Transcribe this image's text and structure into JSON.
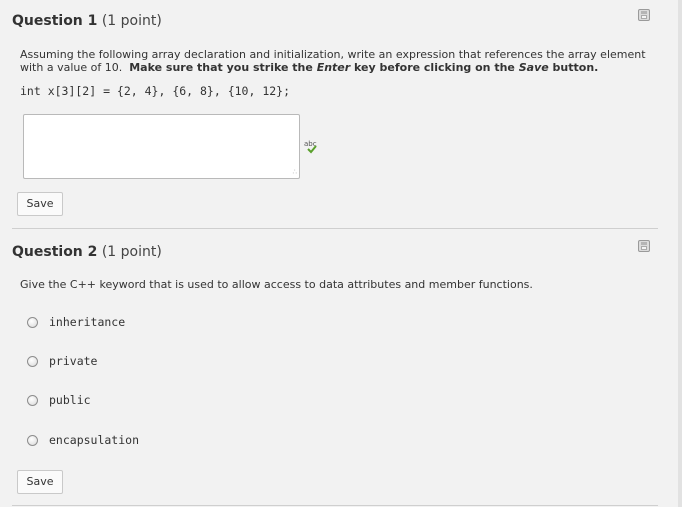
{
  "question1": {
    "title": "Question 1",
    "points": "(1 point)",
    "prompt_part1": "Assuming the following array declaration and initialization, write an expression that references the array element with a value of 10.",
    "prompt_bold1": "Make sure that you strike the",
    "prompt_italic": "Enter",
    "prompt_bold2": "key before clicking on the",
    "prompt_italic2": "Save",
    "prompt_bold3": "button.",
    "code": "int x[3][2] = {2, 4}, {6, 8}, {10, 12};",
    "answer_value": "",
    "save_label": "Save",
    "spell_icon_text": "abc"
  },
  "question2": {
    "title": "Question 2",
    "points": "(1 point)",
    "prompt": "Give the C++ keyword that is used to allow access to data attributes and member functions.",
    "options": [
      "inheritance",
      "private",
      "public",
      "encapsulation"
    ],
    "selected": null,
    "save_label": "Save"
  },
  "colors": {
    "background": "#f2f2f2",
    "text": "#333333",
    "divider": "#cfcfcf"
  }
}
